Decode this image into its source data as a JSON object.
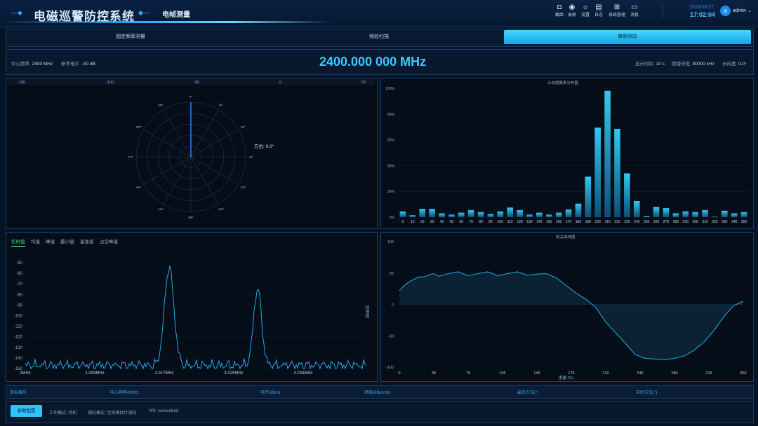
{
  "header": {
    "app_title": "电磁巡警防控系统",
    "page_title": "电帧测量",
    "tools": [
      {
        "label": "截面",
        "icon": "camera-icon"
      },
      {
        "label": "录屏",
        "icon": "record-icon"
      },
      {
        "label": "设置",
        "icon": "gear-icon"
      },
      {
        "label": "日志",
        "icon": "log-icon"
      },
      {
        "label": "系统管理",
        "icon": "grid-icon"
      },
      {
        "label": "消息",
        "icon": "message-icon"
      }
    ],
    "date": "2026/08/27",
    "time": "17:02:04",
    "avatar_letter": "a",
    "user": "admin",
    "accent": "#2aa7ff"
  },
  "tabs": [
    {
      "label": "固定频率测量",
      "active": false
    },
    {
      "label": "频段扫描",
      "active": false
    },
    {
      "label": "单频测向",
      "active": true
    }
  ],
  "info": {
    "center_freq_label": "中心频率",
    "center_freq_value": "2400 MHz",
    "ref_level_label": "参考电平",
    "ref_level_value": "-50 dB",
    "big_freq": "2400.000 000 MHz",
    "display_time_label": "显示时间",
    "display_time_value": "10 s",
    "bandwidth_label": "频谱带宽",
    "bandwidth_value": "80000 kHz",
    "direction_label": "示向度",
    "direction_value": "0.0°"
  },
  "polar": {
    "scale_ticks": [
      "-150",
      "-100",
      "-50",
      "0",
      "50"
    ],
    "angle_labels": [
      "0°",
      "30°",
      "60°",
      "90°",
      "120°",
      "150°",
      "180°",
      "210°",
      "240°",
      "270°",
      "300°",
      "330°"
    ],
    "bearing_label": "方位: 0.0°",
    "bearing_color": "#2f8cff"
  },
  "spectrum": {
    "subtabs": [
      "实时值",
      "均值",
      "峰值",
      "最小值",
      "基准值",
      "占空峰值"
    ],
    "active_subtab": 0,
    "side_label": "频谱图",
    "y_ticks": [
      "-50",
      "-60",
      "-70",
      "-80",
      "-90",
      "-100",
      "-110",
      "-120",
      "-130",
      "-140",
      "-150"
    ],
    "x_ticks": [
      "0MHz",
      "1.008MHz",
      "2.017MHz",
      "3.025MHz",
      "4.034MHz"
    ]
  },
  "chart_data": [
    {
      "type": "bar",
      "title": "示向度概率分布图",
      "categories": [
        "0",
        "10",
        "20",
        "30",
        "40",
        "50",
        "60",
        "70",
        "80",
        "90",
        "100",
        "110",
        "120",
        "130",
        "140",
        "150",
        "160",
        "170",
        "180",
        "190",
        "200",
        "210",
        "220",
        "230",
        "240",
        "250",
        "260",
        "270",
        "280",
        "290",
        "300",
        "310",
        "320",
        "330",
        "340",
        "350"
      ],
      "values": [
        4.5,
        1.5,
        6.5,
        6.5,
        3,
        2,
        3.5,
        5.5,
        4,
        2.5,
        4.5,
        7.5,
        5.5,
        2,
        3.5,
        2,
        3.5,
        6,
        10.5,
        31.5,
        69.5,
        98,
        68.5,
        34,
        12.5,
        1,
        8,
        7,
        3,
        4.5,
        4,
        5.5,
        0.5,
        5,
        3,
        4
      ],
      "ylim": [
        0,
        100
      ],
      "ytick_labels": [
        "0%",
        "20%",
        "40%",
        "60%",
        "80%",
        "100%"
      ],
      "color": "#1fa8d6"
    },
    {
      "type": "area",
      "title": "相关曲线图",
      "xlabel": "度量 (%)",
      "x": [
        0,
        5,
        10,
        15,
        20,
        25,
        30,
        35,
        40,
        50,
        60,
        70,
        80,
        90,
        100,
        110,
        120,
        130,
        140,
        150,
        160,
        170,
        180,
        190,
        200,
        210,
        220,
        230,
        240,
        250,
        260,
        270,
        280,
        290,
        300,
        310,
        320,
        330,
        340,
        350
      ],
      "y": [
        22,
        30,
        36,
        40,
        44,
        46,
        47,
        47,
        47,
        49,
        50,
        48,
        49,
        50,
        48,
        49,
        50,
        49,
        48,
        47,
        42,
        30,
        18,
        8,
        -5,
        -28,
        -45,
        -62,
        -80,
        -86,
        -87,
        -88,
        -86,
        -82,
        -73,
        -60,
        -42,
        -20,
        -2,
        5
      ],
      "xlim": [
        0,
        350
      ],
      "ylim": [
        -100,
        100
      ],
      "x_ticks": [
        "0",
        "35",
        "70",
        "105",
        "140",
        "175",
        "210",
        "245",
        "280",
        "315",
        "350"
      ],
      "y_ticks": [
        "100",
        "50",
        "0",
        "-50",
        "-100"
      ],
      "color": "#1fb2e6"
    }
  ],
  "table_header": [
    "目标编号",
    "中心频率(MHz)",
    "电平(dBm)",
    "场强(dBμV/m)",
    "最优方位(°)",
    "实时方位(°)"
  ],
  "footer": {
    "button": "参数配置",
    "work_mode": "工作模式: 待机",
    "df_mode": "测向模式: 空间谱估计测向",
    "ws": "WS: subscribed"
  }
}
